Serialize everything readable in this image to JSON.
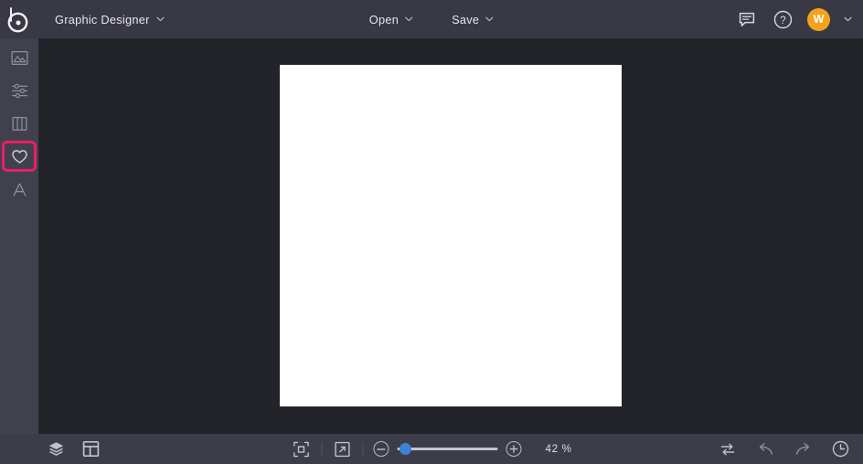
{
  "app": {
    "name": "BeFunky",
    "logo_icon": "befunky-color-wheel-logo"
  },
  "header": {
    "project_title": "Graphic Designer",
    "project_caret_icon": "chevron-down-icon",
    "open_label": "Open",
    "open_caret_icon": "chevron-down-icon",
    "save_label": "Save",
    "save_caret_icon": "chevron-down-icon",
    "feedback_icon": "comment-icon",
    "help_icon": "question-circle-icon",
    "avatar_initial": "W",
    "avatar_color": "#f3a31c",
    "avatar_caret_icon": "chevron-down-icon"
  },
  "sidebar": {
    "selected_index": 3,
    "selection_color": "#ec1e63",
    "items": [
      {
        "name": "image",
        "icon": "image-icon",
        "selected": false
      },
      {
        "name": "edit",
        "icon": "sliders-icon",
        "selected": false
      },
      {
        "name": "templates",
        "icon": "columns-icon",
        "selected": false
      },
      {
        "name": "graphics",
        "icon": "heart-icon",
        "selected": true
      },
      {
        "name": "text",
        "icon": "text-a-icon",
        "selected": false
      }
    ]
  },
  "canvas": {
    "background": "#ffffff",
    "workspace_background": "#23232a"
  },
  "bottombar": {
    "layers_icon": "layers-icon",
    "panel_icon": "layout-panel-icon",
    "fit_icon": "fit-to-screen-icon",
    "expand_icon": "expand-arrow-icon",
    "zoom_out_label": "−",
    "zoom_out_icon": "minus-circle-icon",
    "zoom_in_label": "+",
    "zoom_in_icon": "plus-circle-icon",
    "zoom_value": "42 %",
    "zoom_percent": 42,
    "slider_position_percent": 8,
    "slider_accent": "#3b82d8",
    "compare_icon": "swap-arrows-icon",
    "undo_icon": "undo-arrow-icon",
    "redo_icon": "redo-arrow-icon",
    "history_icon": "history-clock-icon"
  }
}
